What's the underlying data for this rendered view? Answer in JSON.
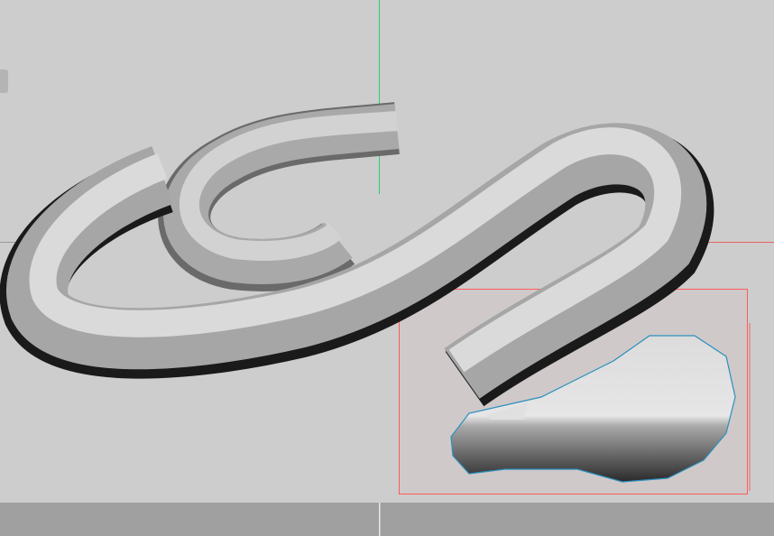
{
  "viewport": {
    "background_color": "#cdcdcd",
    "selection_color": "#ff5a5a",
    "y_axis_color": "#2ecc71",
    "x_axis_color": "#e86060",
    "outline_color": "#2a8fc0"
  },
  "icons": [
    "panel-toggle-icon"
  ]
}
